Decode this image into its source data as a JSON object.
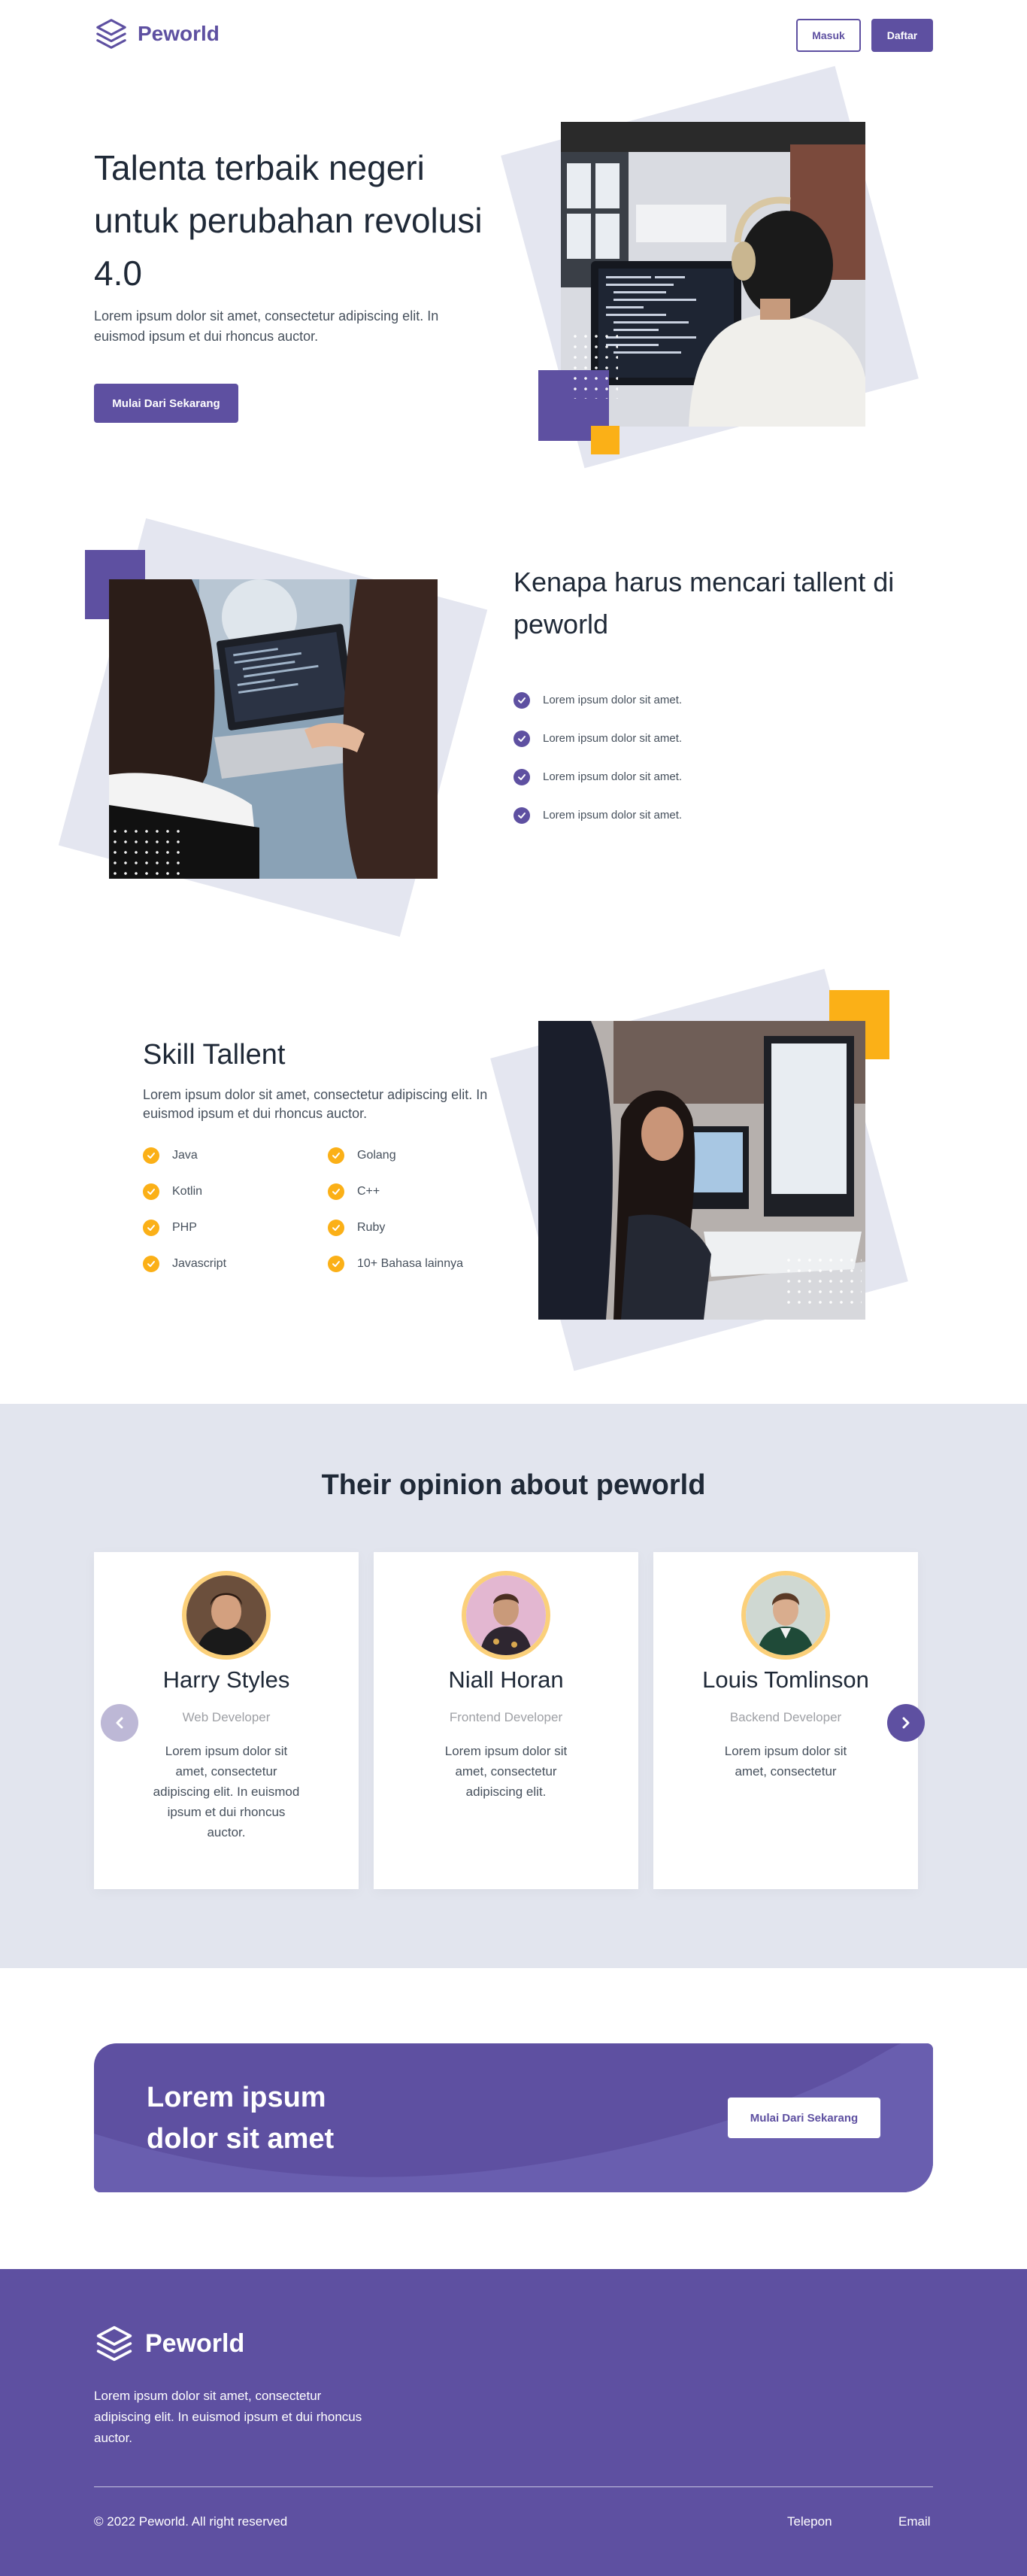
{
  "colors": {
    "primary": "#5e50a1",
    "accent": "#fbb017",
    "section_bg": "#e2e5ee"
  },
  "nav": {
    "brand": "Peworld",
    "logo_icon": "stacked-layers-icon",
    "login_label": "Masuk",
    "register_label": "Daftar"
  },
  "hero": {
    "title": "Talenta terbaik negeri untuk perubahan revolusi 4.0",
    "description": "Lorem ipsum dolor sit amet, consectetur adipiscing elit. In euismod ipsum et dui rhoncus auctor.",
    "cta_label": "Mulai Dari Sekarang"
  },
  "why": {
    "title": "Kenapa harus mencari tallent di peworld",
    "items": [
      "Lorem ipsum dolor sit amet.",
      "Lorem ipsum dolor sit amet.",
      "Lorem ipsum dolor sit amet.",
      "Lorem ipsum dolor sit amet."
    ]
  },
  "skills": {
    "title": "Skill Tallent",
    "description": "Lorem ipsum dolor sit amet, consectetur adipiscing elit. In euismod ipsum et dui rhoncus auctor.",
    "items": [
      "Java",
      "Golang",
      "Kotlin",
      "C++",
      "PHP",
      "Ruby",
      "Javascript",
      "10+ Bahasa lainnya"
    ]
  },
  "testimonials": {
    "title": "Their opinion about peworld",
    "cards": [
      {
        "name": "Harry Styles",
        "role": "Web Developer",
        "quote": "Lorem ipsum dolor sit amet, consectetur adipiscing elit. In euismod ipsum et dui rhoncus auctor."
      },
      {
        "name": "Niall Horan",
        "role": "Frontend Developer",
        "quote": "Lorem ipsum dolor sit amet, consectetur adipiscing elit."
      },
      {
        "name": "Louis Tomlinson",
        "role": "Backend Developer",
        "quote": "Lorem ipsum dolor sit amet, consectetur"
      }
    ]
  },
  "cta": {
    "title": "Lorem ipsum dolor sit amet",
    "button_label": "Mulai Dari Sekarang"
  },
  "footer": {
    "brand": "Peworld",
    "description": "Lorem ipsum dolor sit amet, consectetur adipiscing elit. In euismod ipsum et dui rhoncus auctor.",
    "copyright": "© 2022 Peworld. All right reserved",
    "links": [
      "Telepon",
      "Email"
    ]
  }
}
